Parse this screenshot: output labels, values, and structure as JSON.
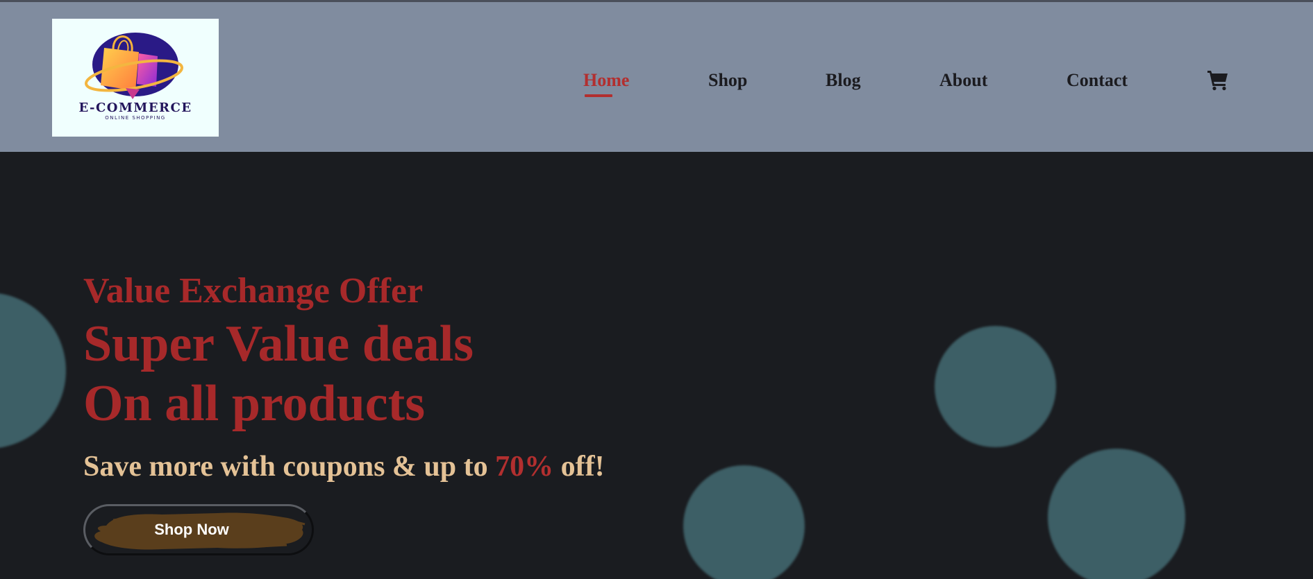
{
  "brand": {
    "name": "E-COMMERCE",
    "tagline": "ONLINE SHOPPING"
  },
  "nav": {
    "items": [
      {
        "label": "Home",
        "active": true
      },
      {
        "label": "Shop",
        "active": false
      },
      {
        "label": "Blog",
        "active": false
      },
      {
        "label": "About",
        "active": false
      },
      {
        "label": "Contact",
        "active": false
      }
    ],
    "cart_icon": "shopping-cart-icon"
  },
  "hero": {
    "eyebrow": "Value Exchange Offer",
    "headline_line1": "Super Value deals",
    "headline_line2": "On all products",
    "tagline_prefix": "Save more with coupons & up to",
    "tagline_highlight": "70%",
    "tagline_suffix": "off!",
    "cta_label": "Shop Now"
  },
  "colors": {
    "header_bg": "#808c9f",
    "hero_bg": "#1a1c20",
    "accent_red": "#a7292a",
    "tagline_tan": "#e4c296",
    "blob_teal": "#3d5f66",
    "cta_brush": "#5a3e1c",
    "brand_navy": "#23155c"
  }
}
